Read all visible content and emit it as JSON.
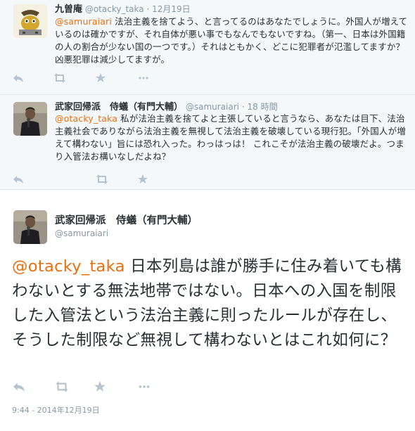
{
  "tweets": [
    {
      "name": "九曽庵",
      "handle": "@otacky_taka",
      "separator": "·",
      "time": "12月19日",
      "mention": "@samuraiari",
      "text": " 法治主義を捨てよう、と言ってるのはあなたでしょうに。外国人が増えているのは確かですが、それ自体が悪い事でもなんでもないですね。（第一、日本は外国籍の人の割合が少ない国の一つです。）それはともかく、どこに犯罪者が氾濫してますか？凶悪犯罪は減少してますが。"
    },
    {
      "name": "武家回帰派　侍蟻（有門大輔）",
      "handle": "@samuraiari",
      "separator": "·",
      "time": "18 時間",
      "mention": "@otacky_taka",
      "text": " 私が法治主義を捨てよと主張していると言うなら、あなたは目下、法治主義社会でありながら法治主義を無視して法治主義を破壊している現行犯。「外国人が増えて構わない」旨には恐れ入った。わっはっは！ これこそが法治主義の破壊だよ。つまり入管法お構いなしだよね？"
    }
  ],
  "main": {
    "name": "武家回帰派　侍蟻（有門大輔）",
    "handle": "@samuraiari",
    "mention": "@otacky_taka",
    "text": " 日本列島は誰が勝手に住み着いても構わないとする無法地帯ではない。日本への入国を制限した入管法という法治主義に則ったルールが存在し、そうした制限など無視して構わないとはこれ如何に？",
    "timestamp": "9:44 - 2014年12月19日"
  },
  "icons": {
    "reply": "reply-icon",
    "retweet": "retweet-icon",
    "favorite": "star-icon",
    "more": "more-icon"
  },
  "colors": {
    "mention": "#e8700f",
    "action": "#b8c4cd",
    "reply_bg": "#f5f8fa"
  }
}
